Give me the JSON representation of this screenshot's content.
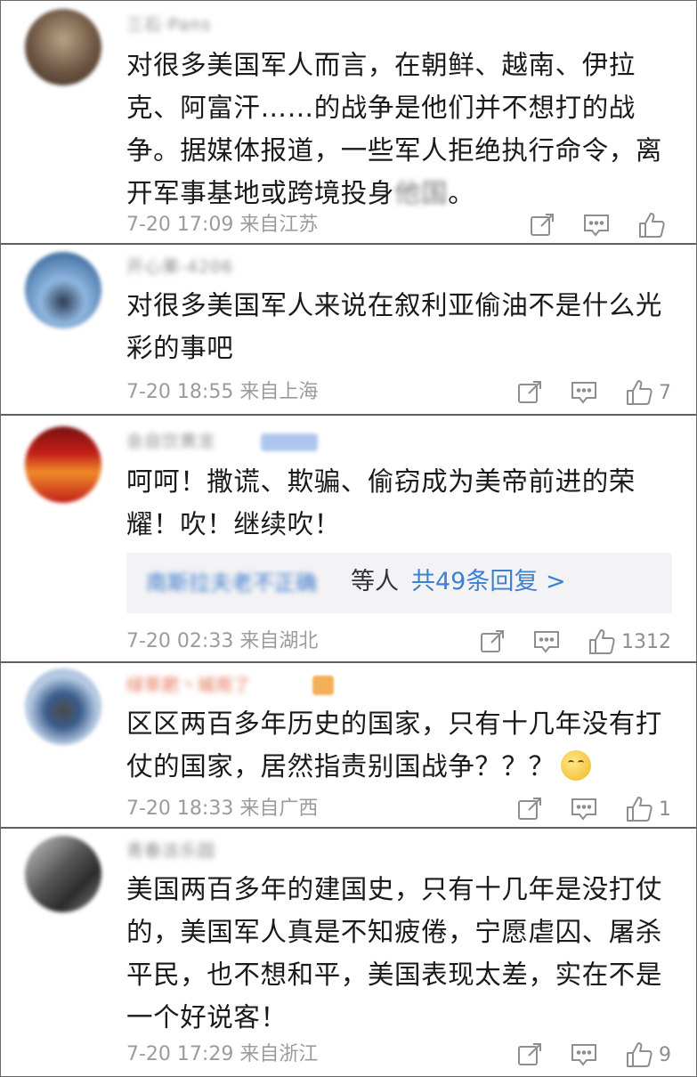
{
  "comments": [
    {
      "username": "三石·Pans",
      "text_a": "对很多美国军人而言，在朝鲜、越南、伊拉克、阿富汗……的战争是他们并不想打的战争。据媒体报道，一些军人拒绝执行命令，离开军事基地或跨境投身",
      "text_blur": "他国",
      "text_b": "。",
      "meta": "7-20 17:09 来自江苏",
      "likes": "",
      "avatar_colors": [
        "#3d2a1f",
        "#b9a184",
        "#6d5643"
      ]
    },
    {
      "username": "开心果-4206",
      "text": "对很多美国军人来说在叙利亚偷油不是什么光彩的事吧",
      "meta": "7-20 18:55 来自上海",
      "likes": "7",
      "avatar_colors": [
        "#1f4f86",
        "#8fb7e0",
        "#2c3b54"
      ]
    },
    {
      "username": "会自饮黄龙",
      "text": "呵呵！撒谎、欺骗、偷窃成为美帝前进的荣耀！吹！继续吹！",
      "reply_names": "南斯拉夫老不正确",
      "reply_etc": "等人",
      "reply_link": "共49条回复 >",
      "meta": "7-20 02:33 来自湖北",
      "likes": "1312",
      "avatar_colors": [
        "#c21f18",
        "#f08b2a",
        "#7a1010"
      ]
    },
    {
      "username": "绿草肥丶城雨了",
      "text": "区区两百多年历史的国家，只有十几年没有打仗的国家，居然指责别国战争？？？",
      "meta": "7-20 18:33 来自广西",
      "likes": "1",
      "avatar_colors": [
        "#3a5c8c",
        "#b7cbe4",
        "#4a4a4a"
      ]
    },
    {
      "username": "青春派乐园",
      "text": "美国两百多年的建国史，只有十几年是没打仗的，美国军人真是不知疲倦，宁愿虐囚、屠杀平民，也不想和平，美国表现太差，实在不是一个好说客！",
      "meta": "7-20 17:29 来自浙江",
      "likes": "9",
      "avatar_colors": [
        "#2b2b2b",
        "#c9c9c9",
        "#575757"
      ]
    }
  ],
  "icons": {
    "share": "share-icon",
    "comment": "comment-icon",
    "like": "thumbs-up-icon",
    "emoji": "thinking-emoji-icon"
  },
  "colors": {
    "meta": "#9b9b9b",
    "link": "#3e7fcf",
    "divider": "#5f5f5f",
    "reply_bg": "#f3f3f5"
  }
}
